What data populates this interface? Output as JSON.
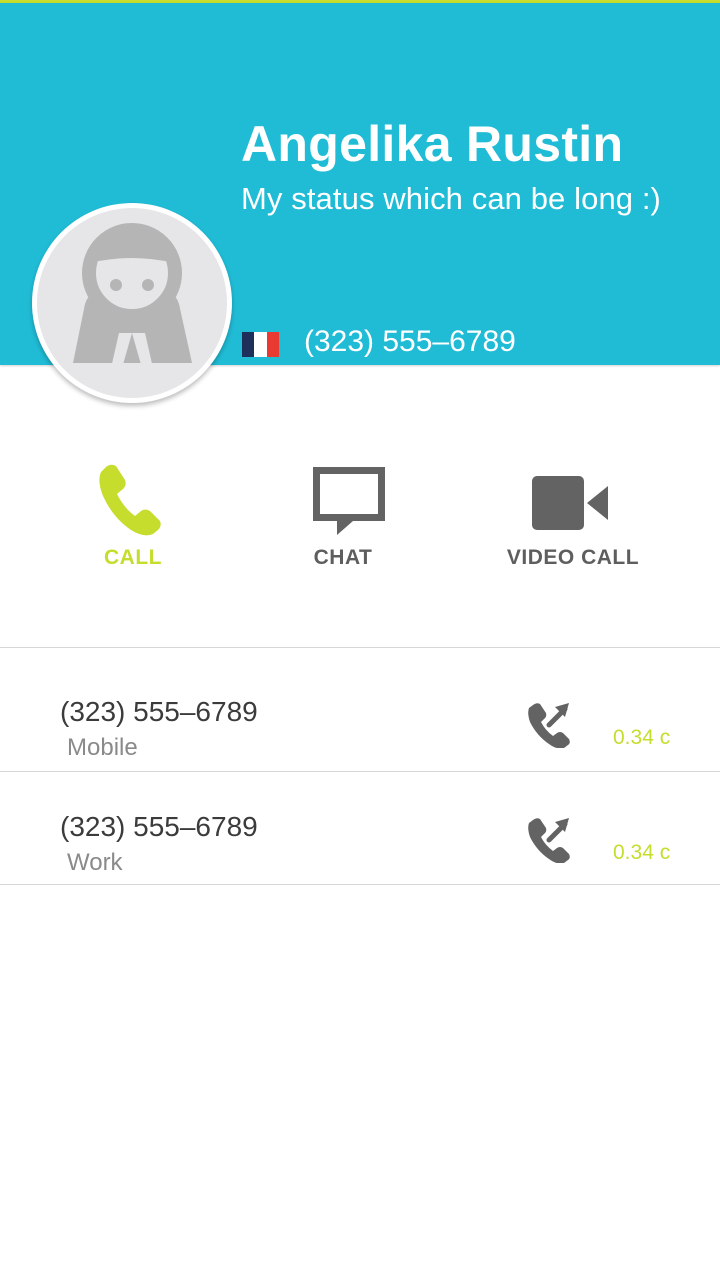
{
  "contact": {
    "name": "Angelika Rustin",
    "status": "My status which can be long :)",
    "phone": "(323) 555–6789",
    "flag_colors": [
      "#1f2f5b",
      "#ffffff",
      "#e83a30"
    ]
  },
  "actions": {
    "call": {
      "label": "CALL",
      "icon": "phone-icon"
    },
    "chat": {
      "label": "CHAT",
      "icon": "chat-bubble-icon"
    },
    "video": {
      "label": "VIDEO CALL",
      "icon": "video-camera-icon"
    }
  },
  "numbers": [
    {
      "number": "(323) 555–6789",
      "type": "Mobile",
      "rate": "0.34 с",
      "icon": "outgoing-call-icon"
    },
    {
      "number": "(323) 555–6789",
      "type": "Work",
      "rate": "0.34 с",
      "icon": "outgoing-call-icon"
    }
  ],
  "colors": {
    "header": "#20bcd6",
    "accent": "#c6dd2e",
    "icon_gray": "#636363"
  }
}
